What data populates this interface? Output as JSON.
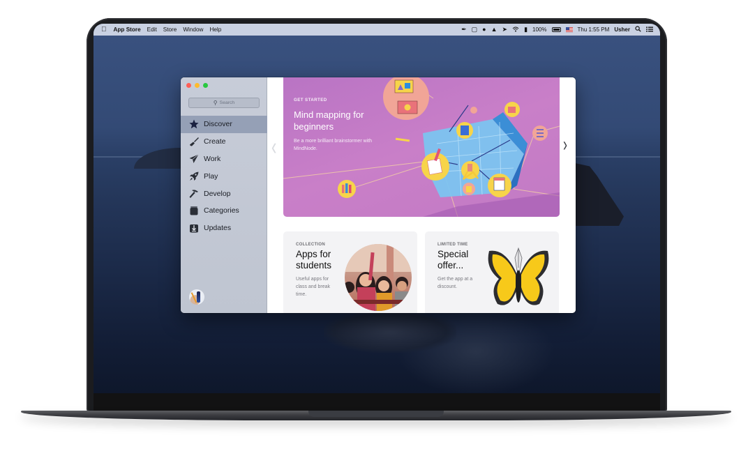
{
  "menubar": {
    "apple_icon": "apple-logo-icon",
    "app_name": "App Store",
    "menus": [
      "Edit",
      "Store",
      "Window",
      "Help"
    ],
    "status_icons": [
      "pen-icon",
      "window-icon",
      "ghost-icon",
      "bell-icon",
      "arrow-icon",
      "wifi-icon",
      "volume-icon"
    ],
    "battery": "100%",
    "input_source_icon": "us-flag-icon",
    "clock": "Thu 1:55 PM",
    "user": "Usher",
    "spotlight_icon": "search-icon",
    "notification_center_icon": "list-icon"
  },
  "window": {
    "search": {
      "placeholder": "Search"
    },
    "nav": [
      {
        "label": "Discover",
        "icon": "star-icon",
        "active": true
      },
      {
        "label": "Create",
        "icon": "brush-icon",
        "active": false
      },
      {
        "label": "Work",
        "icon": "paper-plane-icon",
        "active": false
      },
      {
        "label": "Play",
        "icon": "rocket-icon",
        "active": false
      },
      {
        "label": "Develop",
        "icon": "hammer-icon",
        "active": false
      },
      {
        "label": "Categories",
        "icon": "stack-icon",
        "active": false
      },
      {
        "label": "Updates",
        "icon": "download-icon",
        "active": false
      }
    ],
    "hero": {
      "eyebrow": "GET STARTED",
      "title": "Mind mapping for beginners",
      "subtitle": "Be a more brilliant brainstormer with MindNode.",
      "accent": "#c27ac4"
    },
    "cards": [
      {
        "eyebrow": "COLLECTION",
        "title": "Apps for students",
        "subtitle": "Useful apps for class and break time."
      },
      {
        "eyebrow": "LIMITED TIME",
        "title": "Special offer...",
        "subtitle": "Get the app at a discount."
      }
    ]
  }
}
